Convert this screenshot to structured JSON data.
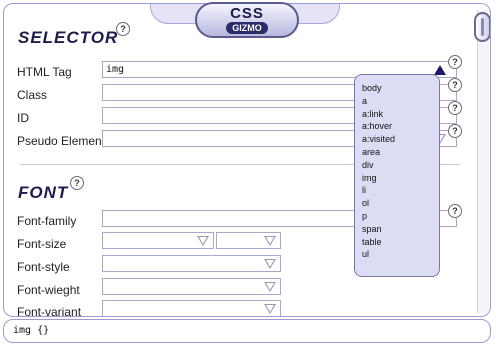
{
  "logo": {
    "line1": "CSS",
    "line2": "GIZMO"
  },
  "help_label": "?",
  "selector_section": {
    "title": "SELECTOR",
    "html_tag": {
      "label": "HTML Tag",
      "value": "img"
    },
    "class": {
      "label": "Class",
      "value": ""
    },
    "id": {
      "label": "ID",
      "value": ""
    },
    "pseudo_element": {
      "label": "Pseudo Element",
      "value": ""
    }
  },
  "font_section": {
    "title": "FONT",
    "font_family": {
      "label": "Font-family",
      "value": ""
    },
    "font_size": {
      "label": "Font-size",
      "value": "",
      "unit": ""
    },
    "font_style": {
      "label": "Font-style",
      "value": ""
    },
    "font_weight": {
      "label": "Font-wieght",
      "value": ""
    },
    "font_variant": {
      "label": "Font-variant",
      "value": ""
    }
  },
  "tag_dropdown": {
    "open": true,
    "selected": "img",
    "options": [
      "body",
      "a",
      "a:link",
      "a:hover",
      "a:visited",
      "area",
      "div",
      "img",
      "li",
      "ol",
      "p",
      "span",
      "table",
      "ul"
    ]
  },
  "status_bar": {
    "text": "img {}"
  },
  "colors": {
    "accent": "#1c1c4e",
    "popup_bg": "#dcdcf5",
    "border": "#9c9cd4"
  },
  "icons": {
    "help": "question-circle-icon",
    "dropdown": "triangle-down-icon",
    "dropdown_open": "triangle-up-icon"
  }
}
